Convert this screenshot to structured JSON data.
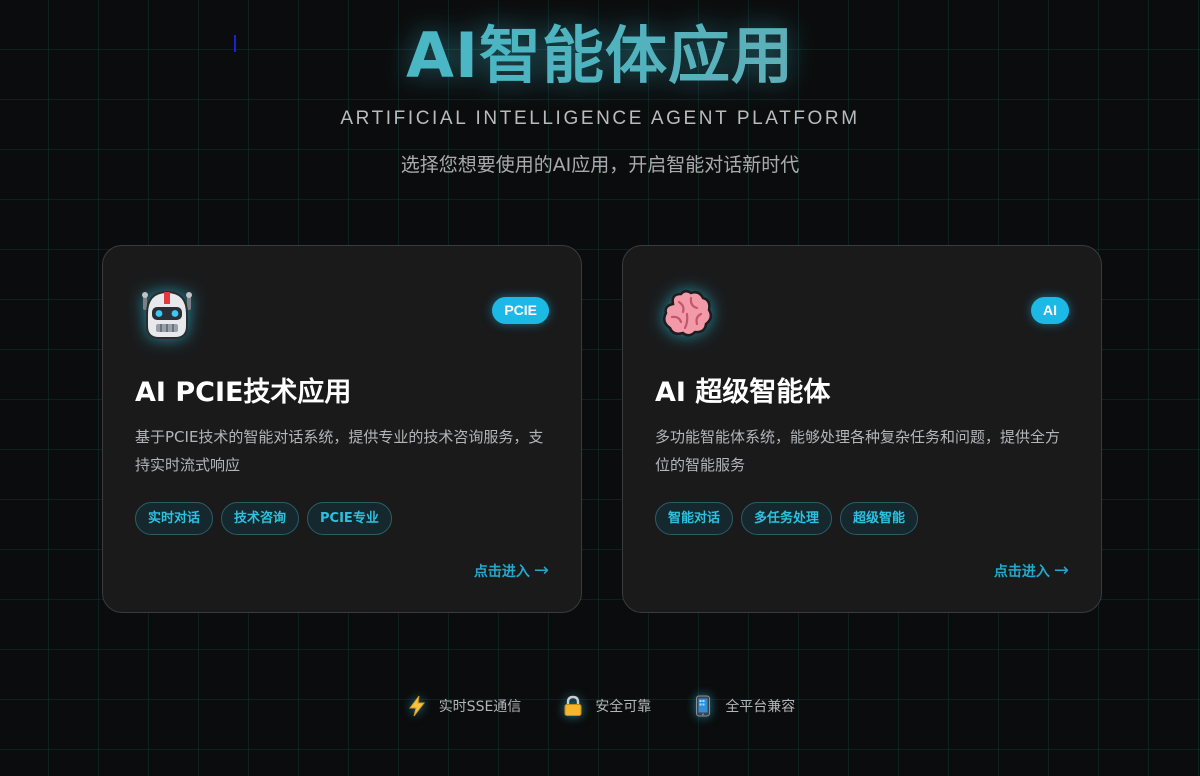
{
  "header": {
    "title": "AI智能体应用",
    "subtitle": "ARTIFICIAL INTELLIGENCE AGENT PLATFORM",
    "tagline": "选择您想要使用的AI应用，开启智能对话新时代"
  },
  "cards": [
    {
      "icon": "robot-icon",
      "badge": "PCIE",
      "title": "AI PCIE技术应用",
      "description": "基于PCIE技术的智能对话系统，提供专业的技术咨询服务，支持实时流式响应",
      "tags": [
        "实时对话",
        "技术咨询",
        "PCIE专业"
      ],
      "enter_label": "点击进入",
      "enter_arrow": "→"
    },
    {
      "icon": "brain-icon",
      "badge": "AI",
      "title": "AI 超级智能体",
      "description": "多功能智能体系统，能够处理各种复杂任务和问题，提供全方位的智能服务",
      "tags": [
        "智能对话",
        "多任务处理",
        "超级智能"
      ],
      "enter_label": "点击进入",
      "enter_arrow": "→"
    }
  ],
  "features": [
    {
      "icon": "lightning-icon",
      "label": "实时SSE通信"
    },
    {
      "icon": "lock-icon",
      "label": "安全可靠"
    },
    {
      "icon": "mobile-phone-icon",
      "label": "全平台兼容"
    }
  ],
  "colors": {
    "accent": "#1cb8e6",
    "title_gradient_start": "#3fc0d4",
    "title_gradient_end": "#7fa7a9",
    "card_background": "#1a1a1b",
    "page_background": "#0b0c0d"
  }
}
